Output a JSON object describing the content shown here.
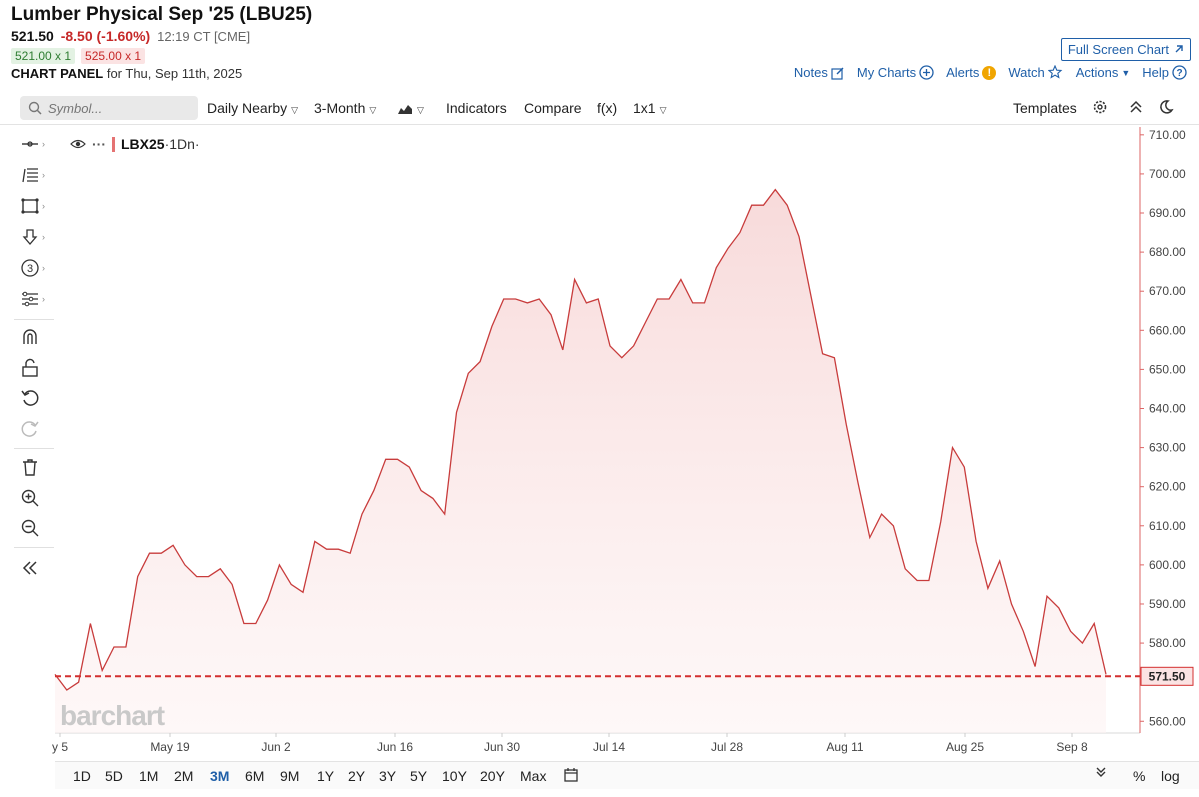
{
  "header": {
    "title": "Lumber Physical Sep '25 (LBU25)",
    "last": "521.50",
    "change": "-8.50 (-1.60%)",
    "time": "12:19 CT [CME]",
    "bid": "521.00 x 1",
    "ask": "525.00 x 1",
    "panel_label": "CHART PANEL",
    "panel_date": "for Thu, Sep 11th, 2025"
  },
  "top_links": {
    "fullscreen": "Full Screen Chart",
    "notes": "Notes",
    "my_charts": "My Charts",
    "alerts": "Alerts",
    "watch": "Watch",
    "actions": "Actions",
    "help": "Help"
  },
  "toolbar": {
    "search_placeholder": "Symbol...",
    "daily": "Daily Nearby",
    "range": "3-Month",
    "indicators": "Indicators",
    "compare": "Compare",
    "fx": "f(x)",
    "layout": "1x1",
    "templates": "Templates"
  },
  "legend": {
    "symbol": "LBX25",
    "interval": "·1Dn·"
  },
  "watermark": "barchart",
  "periods": [
    "1D",
    "5D",
    "1M",
    "2M",
    "3M",
    "6M",
    "9M",
    "1Y",
    "2Y",
    "3Y",
    "5Y",
    "10Y",
    "20Y",
    "Max"
  ],
  "active_period": "3M",
  "bottom_right": {
    "percent": "%",
    "log": "log"
  },
  "colors": {
    "line": "#c83c3c",
    "fill": "#fbe9e9",
    "last_price": "#d32f2f",
    "accent": "#1f5fa8"
  },
  "icons": [
    "crosshair-icon",
    "line-tools-icon",
    "shape-icon",
    "arrow-icon",
    "number-icon",
    "pattern-icon",
    "magnet-icon",
    "lock-icon",
    "undo-icon",
    "redo-icon",
    "trash-icon",
    "zoom-in-icon",
    "zoom-out-icon",
    "collapse-icon"
  ],
  "chart_data": {
    "type": "area",
    "series": [
      {
        "values": [
          572,
          568,
          570,
          585,
          573,
          579,
          579,
          597,
          603,
          603,
          605,
          600,
          597,
          597,
          599,
          595,
          585,
          585,
          591,
          600,
          595,
          593,
          606,
          604,
          604,
          603,
          613,
          619,
          627,
          627,
          625,
          619,
          617,
          613,
          639,
          649,
          652,
          661,
          668,
          668,
          667,
          668,
          664,
          655,
          673,
          667,
          668,
          656,
          653,
          656,
          662,
          668,
          668,
          673,
          667,
          667,
          676,
          681,
          685,
          692,
          692,
          696,
          692,
          684,
          669,
          654,
          653,
          636,
          621,
          607,
          613,
          610,
          599,
          596,
          596,
          611,
          630,
          625,
          606,
          594,
          601,
          590,
          583,
          574,
          592,
          589,
          583,
          580,
          585,
          572
        ]
      }
    ],
    "x_tick_labels": [
      "y 5",
      "May 19",
      "Jun 2",
      "Jun 16",
      "Jun 30",
      "Jul 14",
      "Jul 28",
      "Aug 11",
      "Aug 25",
      "Sep 8"
    ],
    "y_tick_labels": [
      "710.00",
      "700.00",
      "690.00",
      "680.00",
      "670.00",
      "660.00",
      "650.00",
      "640.00",
      "630.00",
      "620.00",
      "610.00",
      "600.00",
      "590.00",
      "580.00",
      "560.00"
    ],
    "y_ticks": [
      710,
      700,
      690,
      680,
      670,
      660,
      650,
      640,
      630,
      620,
      610,
      600,
      590,
      580,
      560
    ],
    "ylim": [
      557,
      712
    ],
    "last_price": 571.5,
    "last_price_label": "571.50",
    "grid": false
  }
}
